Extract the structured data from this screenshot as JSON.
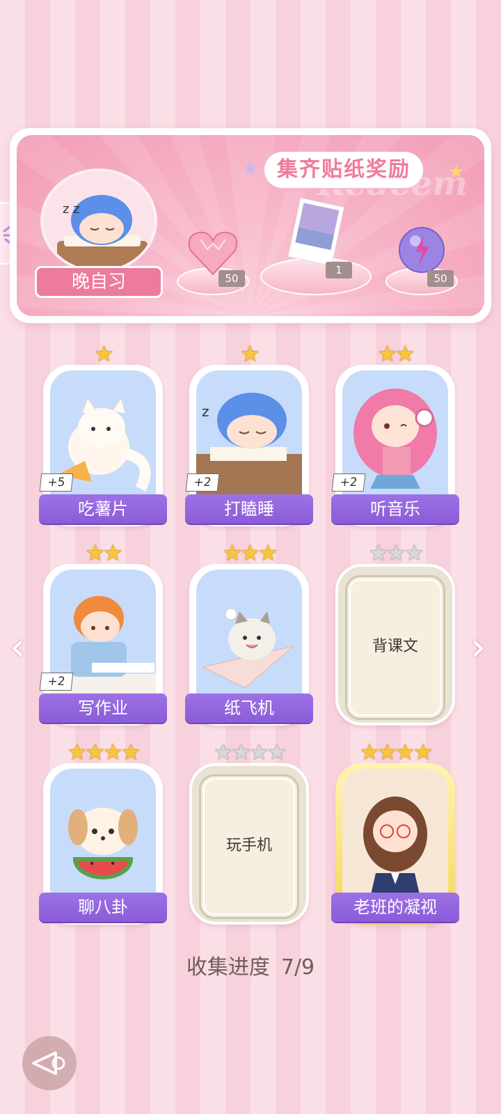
{
  "banner": {
    "title": "集齐贴纸奖励",
    "watermark": "Redeem",
    "avatar_label": "晚自习",
    "rewards": [
      {
        "icon": "heart-gem-icon",
        "count": "50"
      },
      {
        "icon": "photo-card-icon",
        "count": "1"
      },
      {
        "icon": "lightning-orb-icon",
        "count": "50"
      }
    ]
  },
  "cards": [
    {
      "name": "吃薯片",
      "stars": 1,
      "max_stars": 1,
      "bonus": "+5",
      "collected": true
    },
    {
      "name": "打瞌睡",
      "stars": 1,
      "max_stars": 1,
      "bonus": "+2",
      "collected": true
    },
    {
      "name": "听音乐",
      "stars": 2,
      "max_stars": 2,
      "bonus": "+2",
      "collected": true
    },
    {
      "name": "写作业",
      "stars": 2,
      "max_stars": 2,
      "bonus": "+2",
      "collected": true
    },
    {
      "name": "纸飞机",
      "stars": 3,
      "max_stars": 3,
      "bonus": "",
      "collected": true
    },
    {
      "name": "背课文",
      "stars": 0,
      "max_stars": 3,
      "bonus": "",
      "collected": false
    },
    {
      "name": "聊八卦",
      "stars": 4,
      "max_stars": 4,
      "bonus": "",
      "collected": true
    },
    {
      "name": "玩手机",
      "stars": 0,
      "max_stars": 4,
      "bonus": "",
      "collected": false
    },
    {
      "name": "老班的凝视",
      "stars": 4,
      "max_stars": 4,
      "bonus": "",
      "collected": true
    }
  ],
  "progress": {
    "label": "收集进度",
    "value": "7/9"
  },
  "colors": {
    "accent": "#8a5cd8",
    "pink": "#ec7b9e",
    "gold_star": "#f9c53b"
  }
}
